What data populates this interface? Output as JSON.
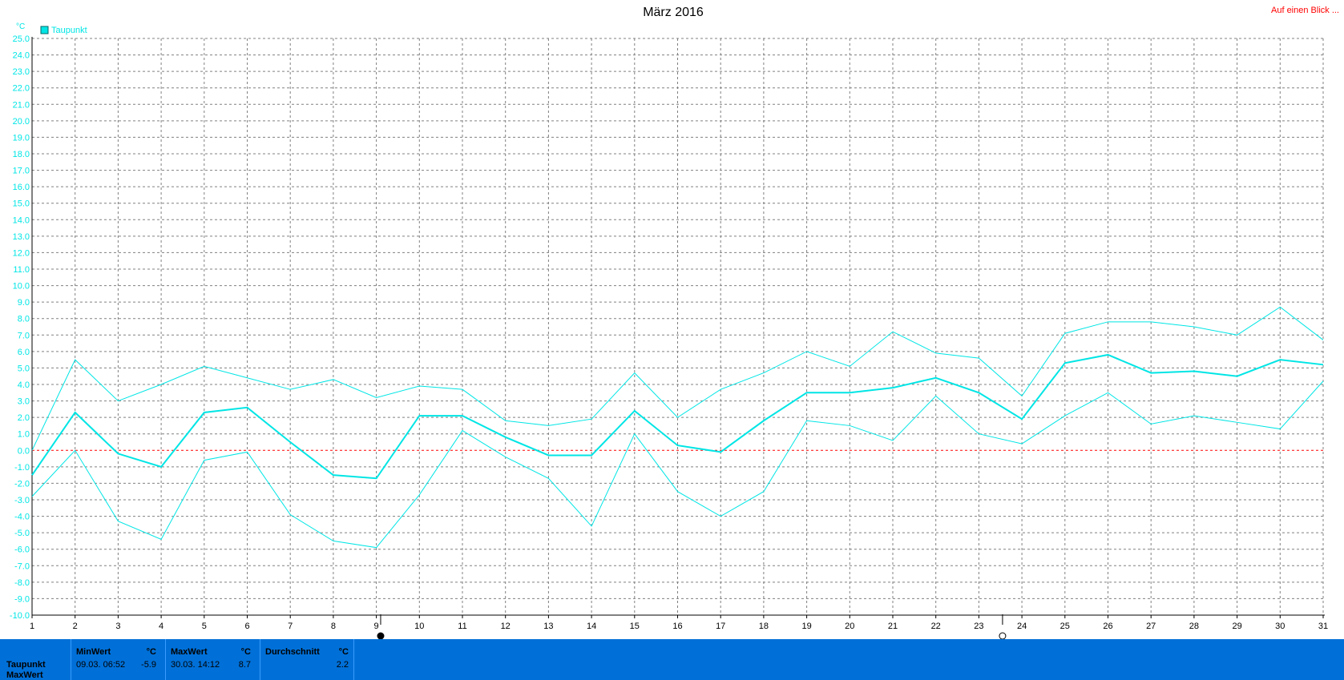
{
  "header": {
    "title": "März 2016",
    "link_label": "Auf einen Blick ..."
  },
  "legend": {
    "label": "Taupunkt",
    "color": "#00e5e5"
  },
  "colors": {
    "series": "#00e5e5",
    "zero_line": "#ff0000",
    "grid": "#808080",
    "panel": "#0070d8"
  },
  "chart_data": {
    "type": "line",
    "title": "März 2016",
    "ylabel": "°C",
    "xlabel": "",
    "ylim": [
      -10,
      25
    ],
    "xlim": [
      1,
      31
    ],
    "grid": true,
    "legend_position": "top-left",
    "x": [
      1,
      2,
      3,
      4,
      5,
      6,
      7,
      8,
      9,
      10,
      11,
      12,
      13,
      14,
      15,
      16,
      17,
      18,
      19,
      20,
      21,
      22,
      23,
      24,
      25,
      26,
      27,
      28,
      29,
      30,
      31
    ],
    "x_tick_labels": [
      "1",
      "2",
      "3",
      "4",
      "5",
      "6",
      "7",
      "8",
      "9",
      "10",
      "11",
      "12",
      "13",
      "14",
      "15",
      "16",
      "17",
      "18",
      "19",
      "20",
      "21",
      "22",
      "23",
      "24",
      "25",
      "26",
      "27",
      "28",
      "29",
      "30",
      "31"
    ],
    "y_tick_labels": [
      "25.0",
      "24.0",
      "23.0",
      "22.0",
      "21.0",
      "20.0",
      "19.0",
      "18.0",
      "17.0",
      "16.0",
      "15.0",
      "14.0",
      "13.0",
      "12.0",
      "11.0",
      "10.0",
      "9.0",
      "8.0",
      "7.0",
      "6.0",
      "5.0",
      "4.0",
      "3.0",
      "2.0",
      "1.0",
      "0.0",
      "-1.0",
      "-2.0",
      "-3.0",
      "-4.0",
      "-5.0",
      "-6.0",
      "-7.0",
      "-8.0",
      "-9.0",
      "-10.0"
    ],
    "series": [
      {
        "name": "Taupunkt",
        "role": "max",
        "values": [
          0.0,
          5.5,
          3.0,
          4.0,
          5.1,
          4.4,
          3.7,
          4.3,
          3.2,
          3.9,
          3.7,
          1.8,
          1.5,
          1.9,
          4.7,
          2.0,
          3.7,
          4.7,
          6.0,
          5.1,
          7.2,
          5.9,
          5.6,
          3.3,
          7.1,
          7.8,
          7.8,
          7.5,
          7.0,
          8.7,
          6.7
        ]
      },
      {
        "name": "Taupunkt",
        "role": "avg",
        "values": [
          -1.5,
          2.3,
          -0.2,
          -1.0,
          2.3,
          2.6,
          0.5,
          -1.5,
          -1.7,
          2.1,
          2.1,
          0.8,
          -0.3,
          -0.3,
          2.4,
          0.3,
          -0.1,
          1.8,
          3.5,
          3.5,
          3.8,
          4.4,
          3.5,
          1.9,
          5.3,
          5.8,
          4.7,
          4.8,
          4.5,
          5.5,
          5.2
        ]
      },
      {
        "name": "Taupunkt",
        "role": "min",
        "values": [
          -2.8,
          0.0,
          -4.3,
          -5.4,
          -0.6,
          -0.1,
          -3.9,
          -5.5,
          -5.9,
          -2.7,
          1.2,
          -0.4,
          -1.7,
          -4.6,
          1.0,
          -2.5,
          -4.0,
          -2.5,
          1.8,
          1.5,
          0.6,
          3.3,
          1.0,
          0.4,
          2.1,
          3.5,
          1.6,
          2.1,
          1.7,
          1.3,
          4.2
        ]
      }
    ],
    "markers": [
      {
        "x": 9.1,
        "kind": "filled-circle"
      },
      {
        "x": 23.55,
        "kind": "open-circle"
      }
    ]
  },
  "stats": {
    "row_label": "Taupunkt",
    "row_label_2": "MaxWert",
    "min": {
      "header": "MinWert",
      "unit": "°C",
      "time": "09.03.  06:52",
      "value": "-5.9"
    },
    "max": {
      "header": "MaxWert",
      "unit": "°C",
      "time": "30.03.  14:12",
      "value": "8.7"
    },
    "avg": {
      "header": "Durchschnitt",
      "unit": "°C",
      "value": "2.2"
    }
  }
}
